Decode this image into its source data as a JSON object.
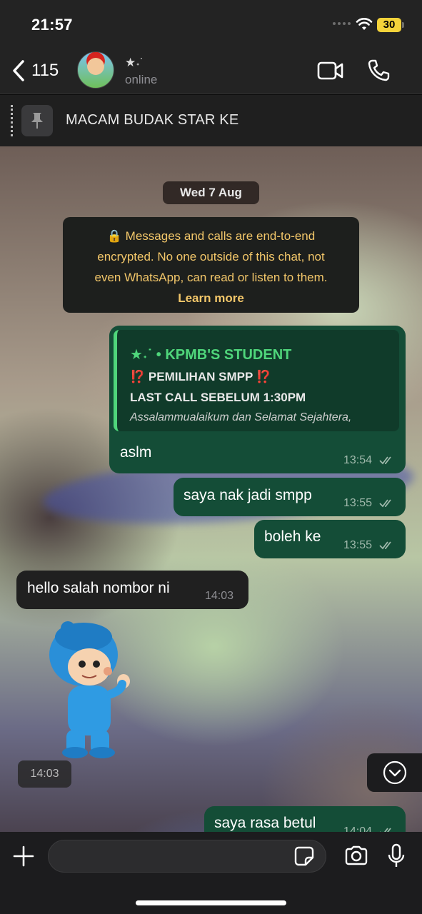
{
  "status_bar": {
    "time": "21:57",
    "battery": "30"
  },
  "header": {
    "back_count": "115",
    "contact_name": "★˖˙",
    "contact_status": "online"
  },
  "pinned": {
    "text": "MACAM BUDAK STAR KE"
  },
  "date_chip": "Wed 7 Aug",
  "encryption_notice": {
    "line1": "🔒 Messages and calls are end-to-end",
    "line2": "encrypted. No one outside of this chat, not",
    "line3": "even WhatsApp, can read or listen to them.",
    "learn_more": "Learn more"
  },
  "messages": [
    {
      "direction": "out",
      "quote": {
        "sender": "★˖˙ • KPMB'S STUDENT",
        "line1": "⁉️ PEMILIHAN SMPP ⁉️",
        "line2": "LAST CALL SEBELUM 1:30PM",
        "line3": "Assalammualaikum dan Selamat Sejahtera,"
      },
      "text": "aslm",
      "time": "13:54"
    },
    {
      "direction": "out",
      "text": "saya nak jadi smpp",
      "time": "13:55"
    },
    {
      "direction": "out",
      "text": "boleh ke",
      "time": "13:55"
    },
    {
      "direction": "in",
      "text": "hello salah nombor ni",
      "time": "14:03"
    },
    {
      "direction": "in",
      "type": "sticker",
      "time": "14:03"
    },
    {
      "direction": "out",
      "text": "saya rasa betul",
      "time": "14:04"
    }
  ],
  "icons": {
    "back": "chevron-left-icon",
    "video": "video-call-icon",
    "call": "phone-icon",
    "pin": "pin-icon",
    "scroll": "chevron-down-icon",
    "attach": "plus-icon",
    "sticker": "sticker-icon",
    "camera": "camera-icon",
    "mic": "microphone-icon"
  },
  "colors": {
    "outgoing_bubble": "#144d37",
    "incoming_bubble": "#202020",
    "quote_accent": "#4fd67b",
    "encryption_text": "#f3c76a",
    "battery": "#f4d33a"
  }
}
